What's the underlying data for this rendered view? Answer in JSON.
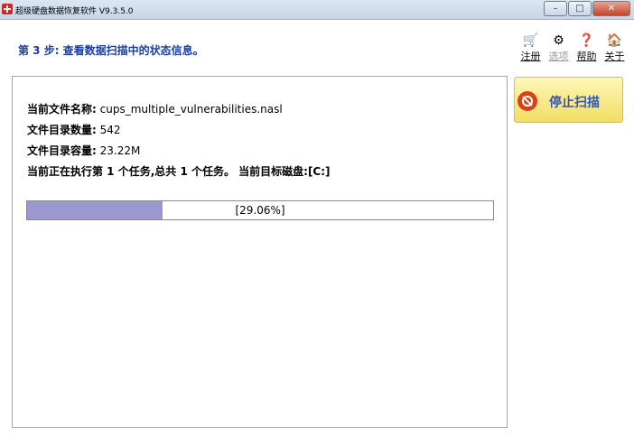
{
  "window": {
    "title": "超级硬盘数据恢复软件 V9.3.5.0"
  },
  "step": {
    "text": "第 3 步:  查看数据扫描中的状态信息。"
  },
  "toolbar": [
    {
      "label": "注册",
      "icon": "cart-icon",
      "enabled": true
    },
    {
      "label": "选项",
      "icon": "gear-icon",
      "enabled": false
    },
    {
      "label": "帮助",
      "icon": "help-icon",
      "enabled": true
    },
    {
      "label": "关于",
      "icon": "house-icon",
      "enabled": true
    }
  ],
  "status": {
    "filename_label": "当前文件名称:",
    "filename": "cups_multiple_vulnerabilities.nasl",
    "count_label": "文件目录数量:",
    "count": "542",
    "size_label": "文件目录容量:",
    "size": "23.22M",
    "task_text": "当前正在执行第 1 个任务,总共 1 个任务。 当前目标磁盘:[C:]"
  },
  "progress": {
    "percent": 29.06,
    "text": "[29.06%]"
  },
  "stop_button": {
    "label": "停止扫描",
    "icon": "stop-icon"
  }
}
